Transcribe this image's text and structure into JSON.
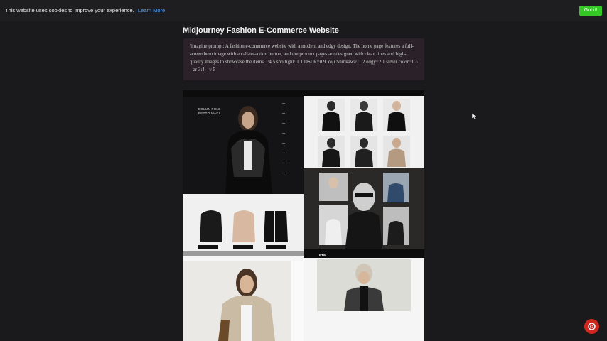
{
  "cookie_banner": {
    "message": "This website uses cookies to improve your experience.",
    "learn_more": "Learn More",
    "got_it": "Got it!"
  },
  "page": {
    "title": "Midjourney Fashion E-Commerce Website",
    "prompt": "/imagine prompt: A fashion e-commerce website with a modern and edgy design. The home page features a full-screen hero image with a call-to-action button, and the product pages are designed with clean lines and high-quality images to showcase the items. ::4.5 spotlight::1.1 DSLR::0.9 Yoji Shinkawa::1.2 edgy::2.1 silver color::1.3 --ar 3:4 --v 5"
  },
  "gallery": {
    "hero_text": "EOLUN FOLD\nBETTO MAKL",
    "logo": "ETW"
  },
  "colors": {
    "accent_green": "#35c826",
    "link_blue": "#4da3ff",
    "chat_red": "#d0271f",
    "prompt_bg": "#2a2228"
  },
  "icons": {
    "chat": "lifebuoy-icon",
    "cursor": "mouse-cursor-icon"
  }
}
